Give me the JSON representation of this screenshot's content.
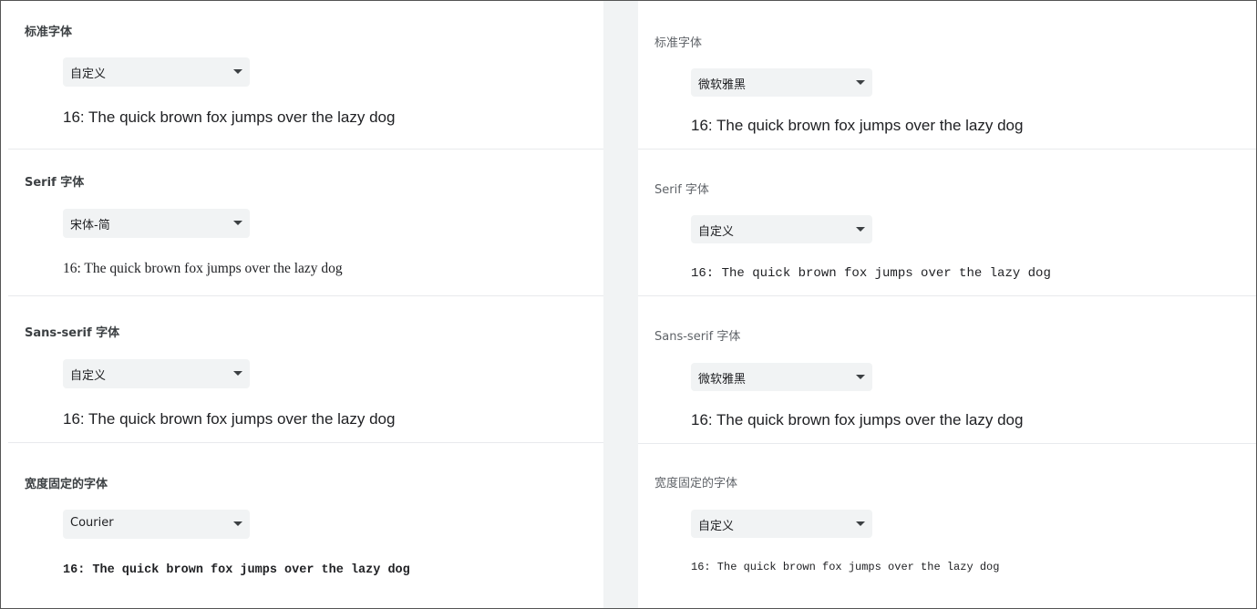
{
  "left": {
    "standard": {
      "label": "标准字体",
      "value": "自定义",
      "sample": "16: The quick brown fox jumps over the lazy dog"
    },
    "serif": {
      "label": "Serif 字体",
      "value": "宋体-简",
      "sample": "16: The quick brown fox jumps over the lazy dog"
    },
    "sans_serif": {
      "label": "Sans-serif 字体",
      "value": "自定义",
      "sample": "16: The quick brown fox jumps over the lazy dog"
    },
    "fixed": {
      "label": "宽度固定的字体",
      "value": "Courier",
      "sample": "16: The quick brown fox jumps over the lazy dog"
    }
  },
  "right": {
    "standard": {
      "label": "标准字体",
      "value": "微软雅黑",
      "sample": "16: The quick brown fox jumps over the lazy dog"
    },
    "serif": {
      "label": "Serif 字体",
      "value": "自定义",
      "sample": "16: The quick brown fox jumps over the lazy dog"
    },
    "sans_serif": {
      "label": "Sans-serif 字体",
      "value": "微软雅黑",
      "sample": "16: The quick brown fox jumps over the lazy dog"
    },
    "fixed": {
      "label": "宽度固定的字体",
      "value": "自定义",
      "sample": "16: The quick brown fox jumps over the lazy dog"
    }
  },
  "icons": {
    "dropdown": "caret-down-icon"
  },
  "colors": {
    "background": "#ffffff",
    "select_bg": "#f1f3f4",
    "divider_strip": "#f1f3f4",
    "text": "#202124"
  }
}
